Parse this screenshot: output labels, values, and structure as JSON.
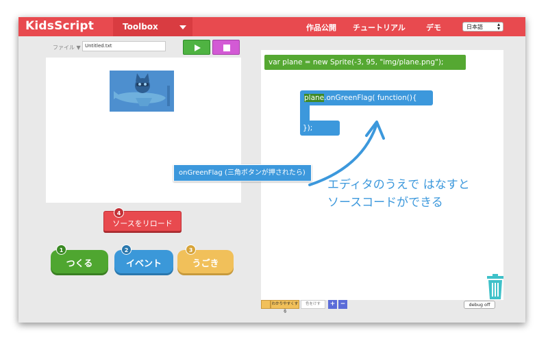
{
  "header": {
    "logo": "KidsScript",
    "toolbox_label": "Toolbox",
    "nav_publish": "作品公開",
    "nav_tutorial": "チュートリアル",
    "nav_demo": "デモ",
    "language": "日本語",
    "accent_color": "#e84a4f"
  },
  "file": {
    "label": "ファイル ▼",
    "filename": "Untitled.txt"
  },
  "controls": {
    "play_icon": "play-icon",
    "stop_icon": "stop-icon"
  },
  "buttons": {
    "reload": {
      "number": "4",
      "label": "ソースをリロード"
    },
    "tsukuru": {
      "number": "1",
      "label": "つくる"
    },
    "event": {
      "number": "2",
      "label": "イベント"
    },
    "ugoki": {
      "number": "3",
      "label": "うごき"
    }
  },
  "editor": {
    "line_var": "var plane = new Sprite(-3, 95, \"img/plane.png\");",
    "handler_object": "plane",
    "handler_rest": ".onGreenFlag(  function(){",
    "handler_close": "});",
    "annotation_line1": "エディタのうえで はなすと",
    "annotation_line2": "ソースコードができる"
  },
  "tooltip": "onGreenFlag (三角ボタンが押されたら)",
  "footer": {
    "easy_label": "わかりやすくする",
    "color_label": "色をけす",
    "zoom_in": "+",
    "zoom_out": "−",
    "debug_label": "debug off"
  }
}
